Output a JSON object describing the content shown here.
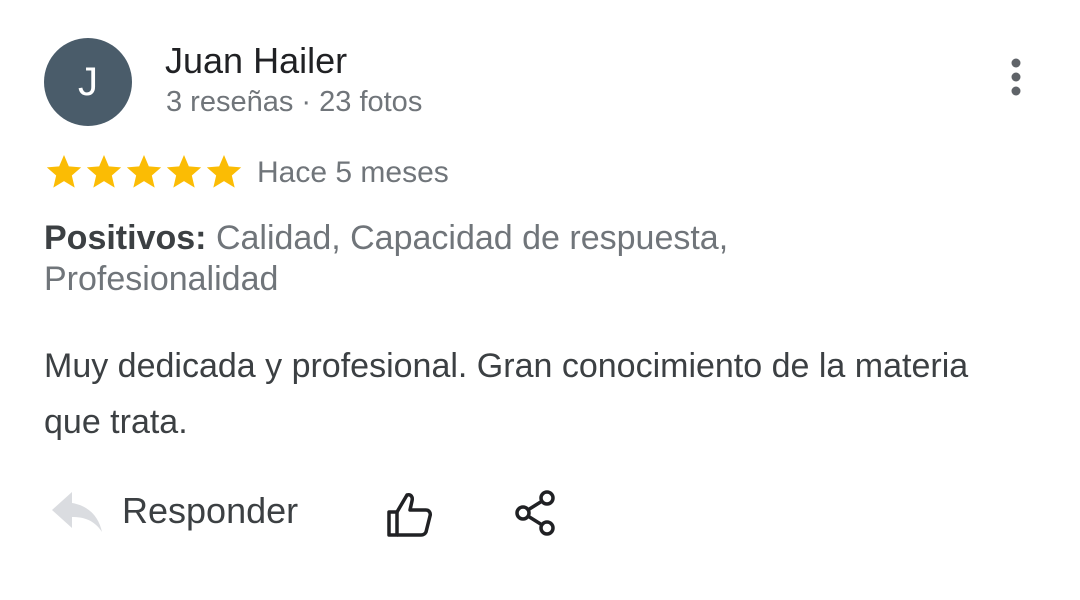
{
  "author": {
    "initial": "J",
    "name": "Juan Hailer",
    "meta": "3 reseñas · 23 fotos",
    "avatar_color": "#4a5c6a"
  },
  "menu": {
    "icon": "more-vert-icon"
  },
  "review": {
    "rating": 5,
    "rating_max": 5,
    "star_color": "#fbbc04",
    "date": "Hace 5 meses",
    "positives_label": "Positivos:",
    "positives_value": "Calidad, Capacidad de respuesta, Profesionalidad",
    "text": "Muy dedicada y profesional. Gran conocimiento de la materia que trata."
  },
  "actions": {
    "reply_label": "Responder",
    "reply_icon": "reply-arrow-icon",
    "like_icon": "thumbs-up-icon",
    "share_icon": "share-icon"
  }
}
